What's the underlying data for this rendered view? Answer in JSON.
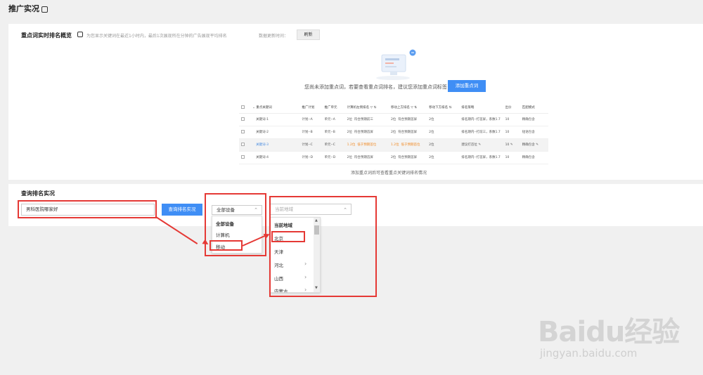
{
  "page": {
    "title": "推广实况"
  },
  "overview": {
    "title": "重点词实时排名概览",
    "hint": "为您显示关键词在最近1小时内，最后1次展现所在分钟的广告展现平均排名",
    "update_label": "数据更新时间：",
    "refresh_label": "刷新",
    "empty_text": "您尚未添加重点词，若要查看重点词排名，建议您添加重点词标签",
    "add_button": "添加重点词",
    "table_footer": "添加重点词后可查看重点关键词排名情况"
  },
  "table": {
    "columns": [
      "重点关键词",
      "推广计划",
      "推广单元",
      "计算机左侧排名",
      "移动上方排名",
      "移动下方排名",
      "排名策略",
      "出价",
      "匹配模式"
    ],
    "rows": [
      {
        "keyword": "关键词-1",
        "plan": "计划--A",
        "unit": "单元--A",
        "pc_rank": "2位",
        "pc_note": "符合预期前三",
        "mobile_top": "2位",
        "mobile_top_note": "符合预期首屏",
        "mobile_bottom": "2位",
        "strategy": "排名期内--打首屏，系数1.7",
        "bid": "10",
        "match": "精确包含"
      },
      {
        "keyword": "关键词-2",
        "plan": "计划--B",
        "unit": "单元--B",
        "pc_rank": "2位",
        "pc_note": "符合预期首屏",
        "mobile_top": "2位",
        "mobile_top_note": "符合预期首屏",
        "mobile_bottom": "2位",
        "strategy": "排名期内--打前三，系数1.7",
        "bid": "10",
        "match": "短语包含"
      },
      {
        "keyword": "关键词-3",
        "plan": "计划--C",
        "unit": "单元--C",
        "pc_rank": "1.2位",
        "pc_note": "低于预期首位",
        "mobile_top": "1.2位",
        "mobile_top_note": "低于预期首位",
        "mobile_bottom": "2位",
        "strategy": "建议打首位",
        "bid": "10",
        "match": "精确包含"
      },
      {
        "keyword": "关键词-4",
        "plan": "计划--D",
        "unit": "单元--D",
        "pc_rank": "2位",
        "pc_note": "符合预期首屏",
        "mobile_top": "2位",
        "mobile_top_note": "符合预期首屏",
        "mobile_bottom": "2位",
        "strategy": "排名期内--打首屏，系数1.7",
        "bid": "10",
        "match": "精确包含"
      }
    ]
  },
  "query": {
    "title": "查询排名实况",
    "keyword_value": "男科医院哪家好",
    "query_button": "查询排名实况",
    "device_selected": "全部设备",
    "device_options": [
      "全部设备",
      "计算机",
      "移动"
    ],
    "region_placeholder": "当前地域",
    "region_options": [
      "当前地域",
      "北京",
      "天津",
      "河北",
      "山西",
      "内蒙古"
    ]
  },
  "watermark": {
    "brand": "Baidu经验",
    "url": "jingyan.baidu.com"
  },
  "colors": {
    "accent": "#3f8ef5",
    "annotation": "#e53935",
    "warning": "#f08a24"
  }
}
